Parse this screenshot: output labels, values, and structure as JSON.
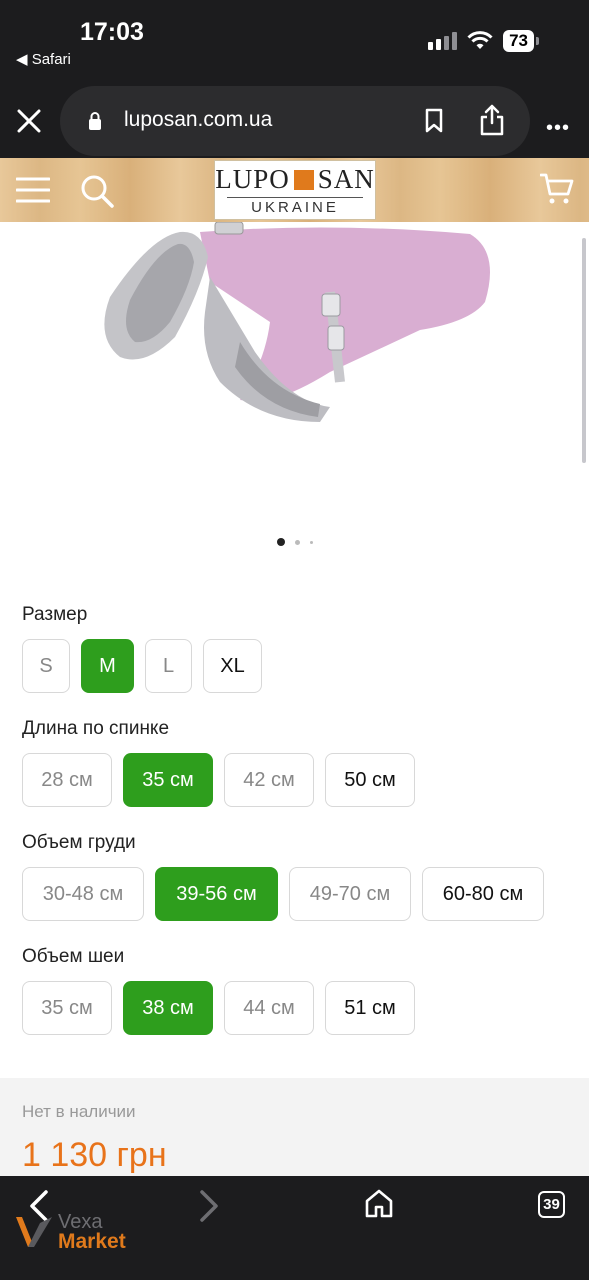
{
  "status_bar": {
    "time": "17:03",
    "back_app": "◀ Safari",
    "battery": "73"
  },
  "browser": {
    "url": "luposan.com.ua",
    "tabs_count": "39"
  },
  "logo": {
    "line1_left": "LUPO",
    "line1_right": "SAN",
    "line2": "UKRAINE",
    "accent": "#e07a1c"
  },
  "gallery": {
    "dots": 3,
    "active": 0
  },
  "options": [
    {
      "label": "Размер",
      "values": [
        "S",
        "M",
        "L",
        "XL"
      ],
      "selected": 1
    },
    {
      "label": "Длина по спинке",
      "values": [
        "28 см",
        "35 см",
        "42 см",
        "50 см"
      ],
      "selected": 1
    },
    {
      "label": "Объем груди",
      "values": [
        "30-48 см",
        "39-56 см",
        "49-70 см",
        "60-80 см"
      ],
      "selected": 1
    },
    {
      "label": "Объем шеи",
      "values": [
        "35 см",
        "38 см",
        "44 см",
        "51 см"
      ],
      "selected": 1
    }
  ],
  "availability": "Нет в наличии",
  "price": "1 130 грн",
  "watermark": {
    "line1": "Vexa",
    "line2": "Market"
  },
  "colors": {
    "selected": "#2e9e1d",
    "price": "#e8731a"
  }
}
